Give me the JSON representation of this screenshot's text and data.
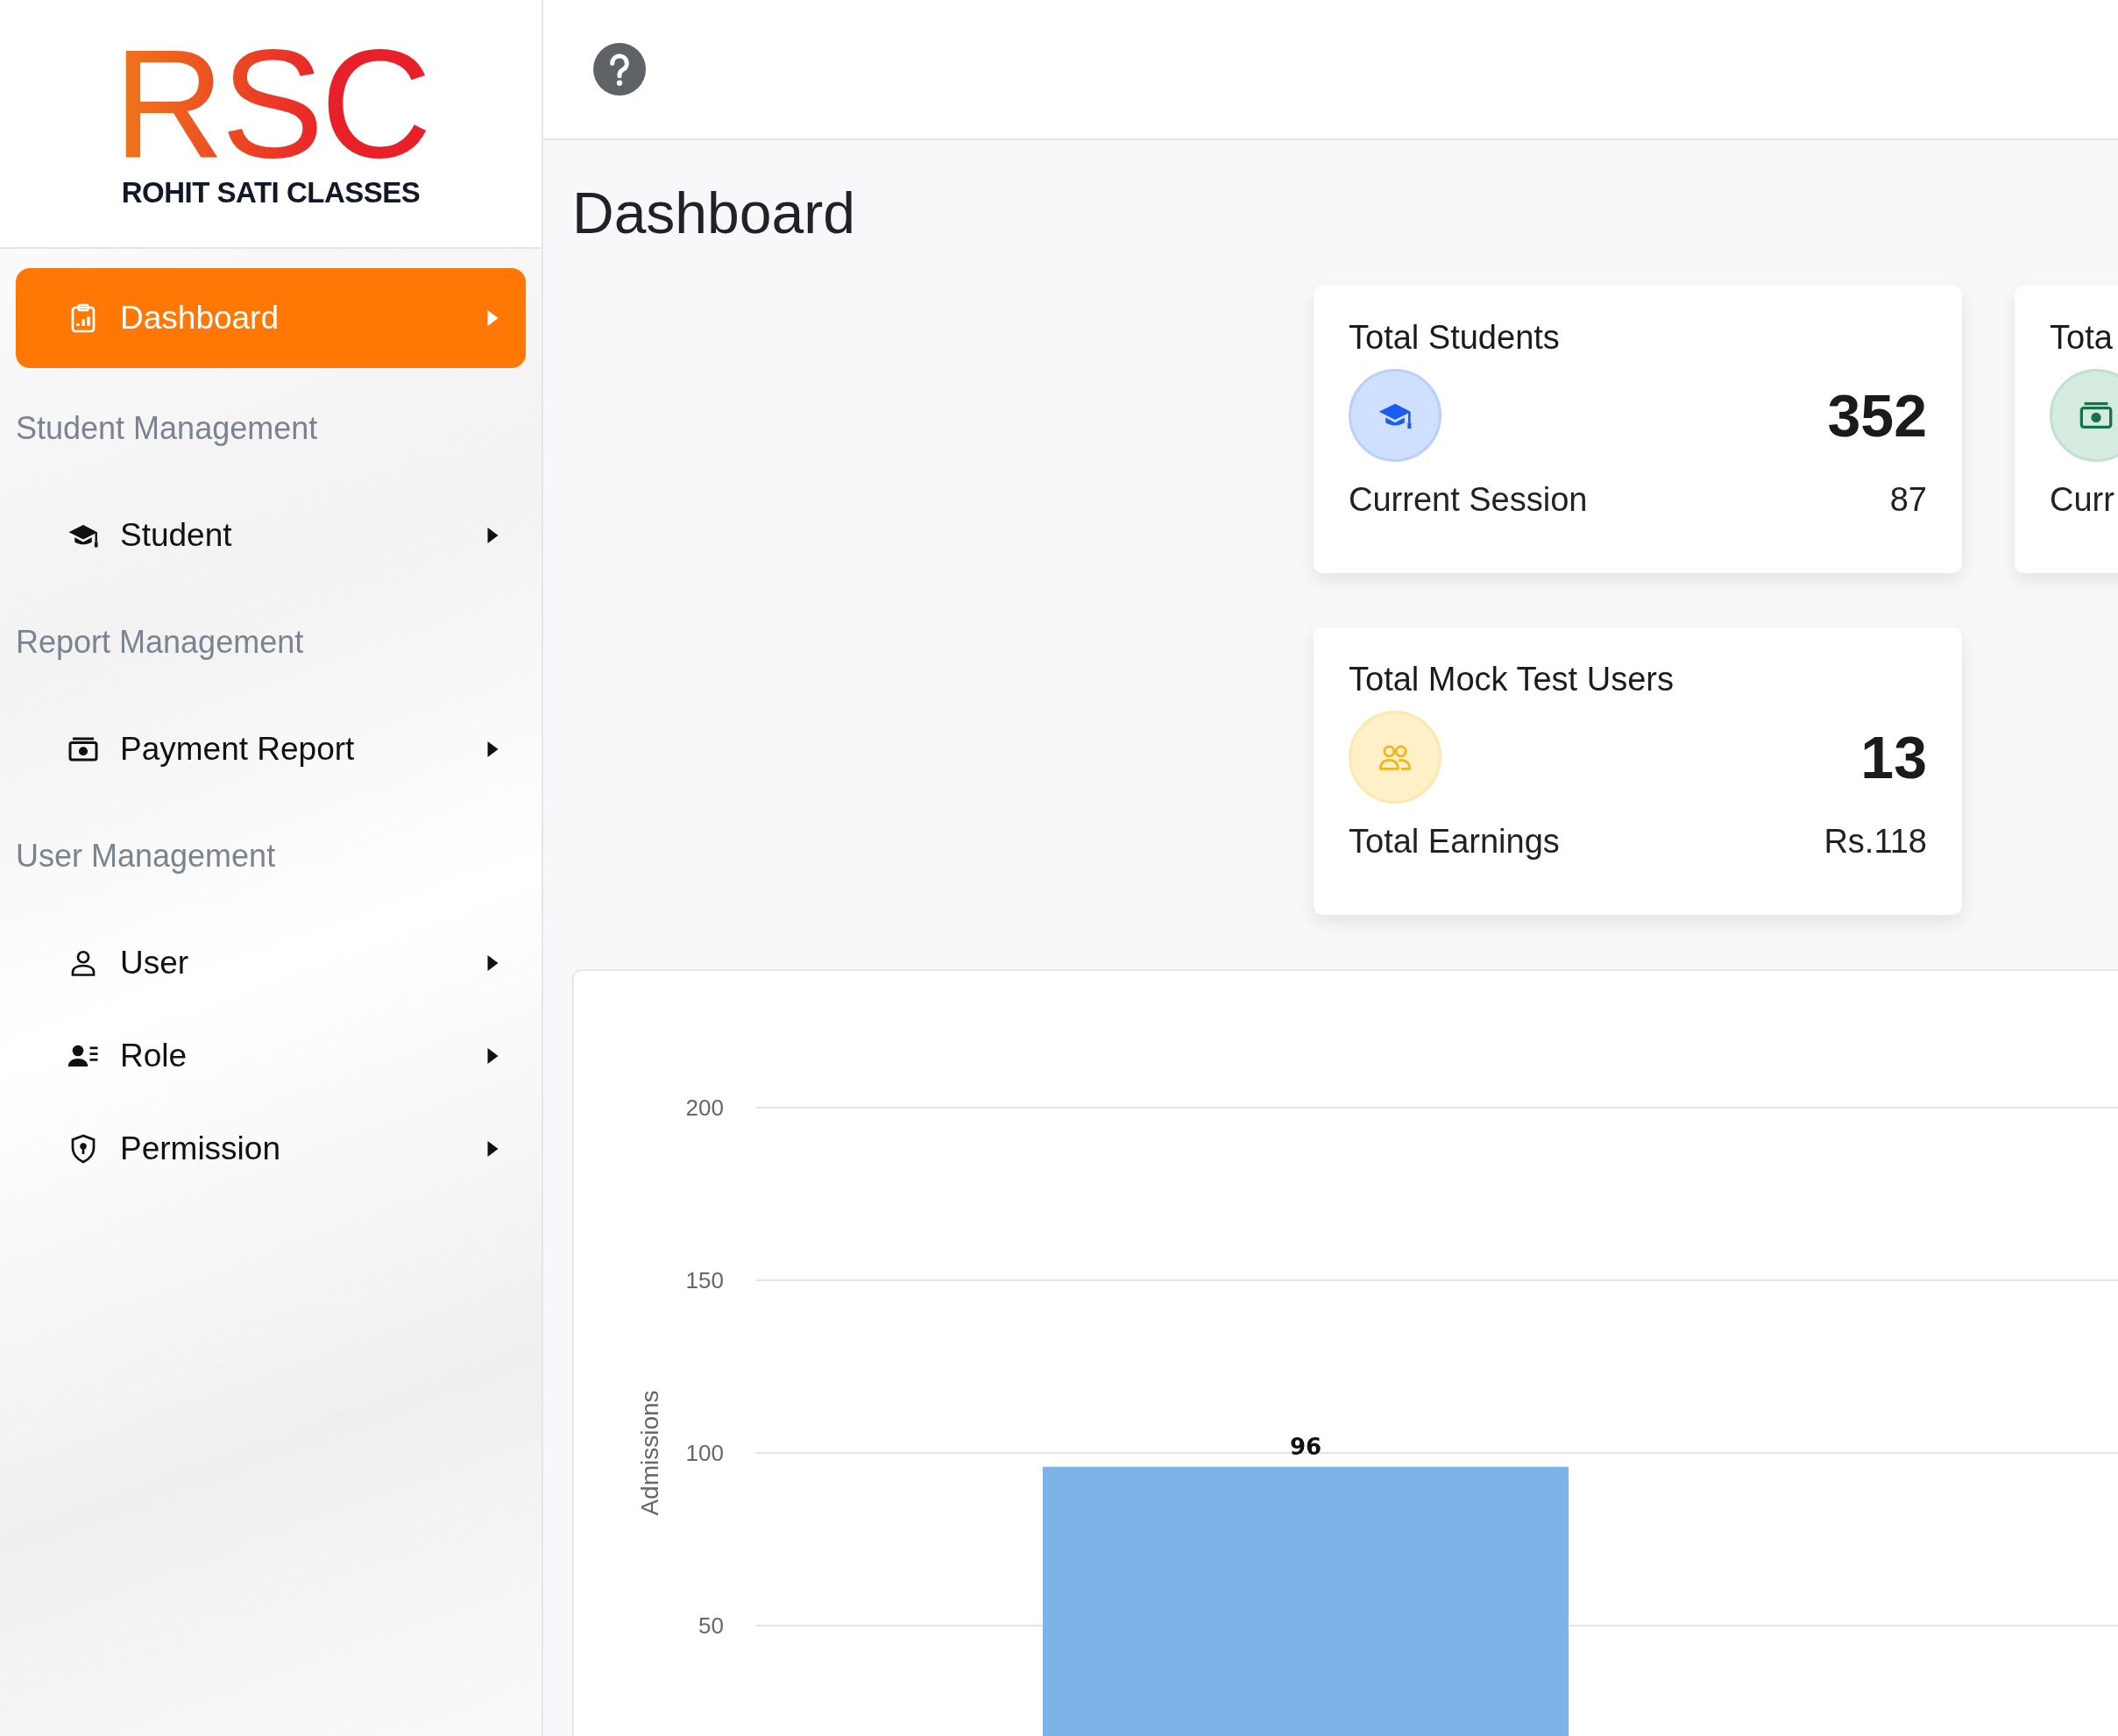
{
  "logo": {
    "mark": "RSC",
    "name": "ROHIT SATI CLASSES"
  },
  "sidebar": {
    "items": [
      {
        "kind": "link",
        "label": "Dashboard",
        "selected": true
      },
      {
        "kind": "heading",
        "label": "Student Management"
      },
      {
        "kind": "link",
        "label": "Student",
        "selected": false
      },
      {
        "kind": "heading",
        "label": "Report Management"
      },
      {
        "kind": "link",
        "label": "Payment Report",
        "selected": false
      },
      {
        "kind": "heading",
        "label": "User Management"
      },
      {
        "kind": "link",
        "label": "User",
        "selected": false
      },
      {
        "kind": "link",
        "label": "Role",
        "selected": false
      },
      {
        "kind": "link",
        "label": "Permission",
        "selected": false
      }
    ]
  },
  "page": {
    "title": "Dashboard"
  },
  "cards": [
    {
      "title": "Total Students",
      "value": "352",
      "sub_label": "Current Session",
      "sub_value": "87"
    },
    {
      "title": "Tota",
      "sub_label": "Curr"
    },
    {
      "title": "Total Mock Test Users",
      "value": "13",
      "sub_label": "Total Earnings",
      "sub_value": "Rs.118"
    }
  ],
  "chart": {
    "chart_data": {
      "type": "bar",
      "ylabel": "Admissions",
      "grid": true,
      "ylim": [
        0,
        200
      ],
      "yticks": [
        50,
        100,
        150,
        200
      ],
      "values": [
        96
      ],
      "data_labels": true
    }
  }
}
